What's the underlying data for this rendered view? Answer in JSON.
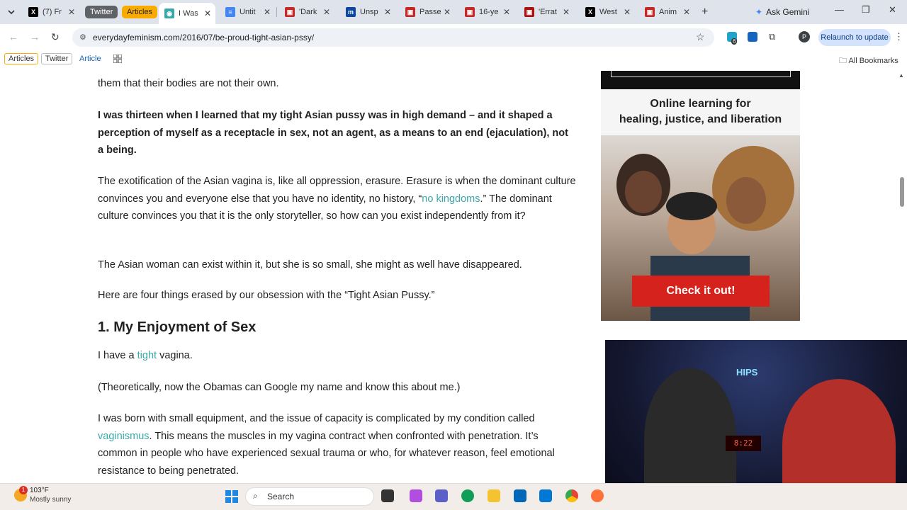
{
  "browser": {
    "tabs": [
      {
        "title": "(7) Fr",
        "favicon": "x-icon"
      },
      {
        "title": "I Was",
        "favicon": "everydayfeminism-icon",
        "active": true
      },
      {
        "title": "Untit",
        "favicon": "docs-icon"
      },
      {
        "title": "'Dark",
        "favicon": "news-icon"
      },
      {
        "title": "Unsp",
        "favicon": "m-icon"
      },
      {
        "title": "Passe",
        "favicon": "news-icon"
      },
      {
        "title": "16-ye",
        "favicon": "news-icon"
      },
      {
        "title": "'Errat",
        "favicon": "news-icon"
      },
      {
        "title": "West",
        "favicon": "x-icon"
      },
      {
        "title": "Anim",
        "favicon": "news-icon"
      }
    ],
    "tab_groups": {
      "twitter": "Twitter",
      "articles": "Articles"
    },
    "ask_gemini": "Ask Gemini",
    "url": "everydayfeminism.com/2016/07/be-proud-tight-asian-pssy/",
    "relaunch": "Relaunch to update",
    "profile_initial": "P",
    "ext_badge": "6",
    "bookmarks": {
      "articles": "Articles",
      "twitter": "Twitter",
      "article": "Article",
      "all": "All Bookmarks"
    }
  },
  "article": {
    "p0_tail": "them that their bodies are not their own.",
    "p1_bold": "I was thirteen when I learned that my tight Asian pussy was in high demand – and it shaped a perception of myself as a receptacle in sex, not an agent, as a means to an end (ejaculation), not a being.",
    "p2_a": "The exotification of the Asian vagina is, like all oppression, erasure. Erasure is when the dominant culture convinces you and everyone else that you have no identity, no history, “",
    "p2_link": "no kingdoms",
    "p2_b": ".” The dominant culture convinces you that it is the only storyteller, so how can you exist independently from it?",
    "p3": "The Asian woman can exist within it, but she is so small, she might as well have disappeared.",
    "p4": "Here are four things erased by our obsession with the “Tight Asian Pussy.”",
    "h2": "1. My Enjoyment of Sex",
    "p5_a": "I have a ",
    "p5_link": "tight",
    "p5_b": " vagina.",
    "p6": "(Theoretically, now the Obamas can Google my name and know this about me.)",
    "p7_a": "I was born with small equipment, and the issue of capacity is complicated by my condition called ",
    "p7_link": "vaginismus",
    "p7_b": ". This means the muscles in my vagina contract when confronted with penetration. It’s common in people who have experienced sexual trauma or who, for whatever reason, feel emotional resistance to being penetrated."
  },
  "ad": {
    "headline_1": "Online learning for",
    "headline_2": "healing, justice, and liberation",
    "cta": "Check it out!"
  },
  "webcam": {
    "sign": "HIPS",
    "clock": "8:22"
  },
  "taskbar": {
    "weather_badge": "1",
    "temperature": "103°F",
    "condition": "Mostly sunny",
    "search": "Search"
  }
}
